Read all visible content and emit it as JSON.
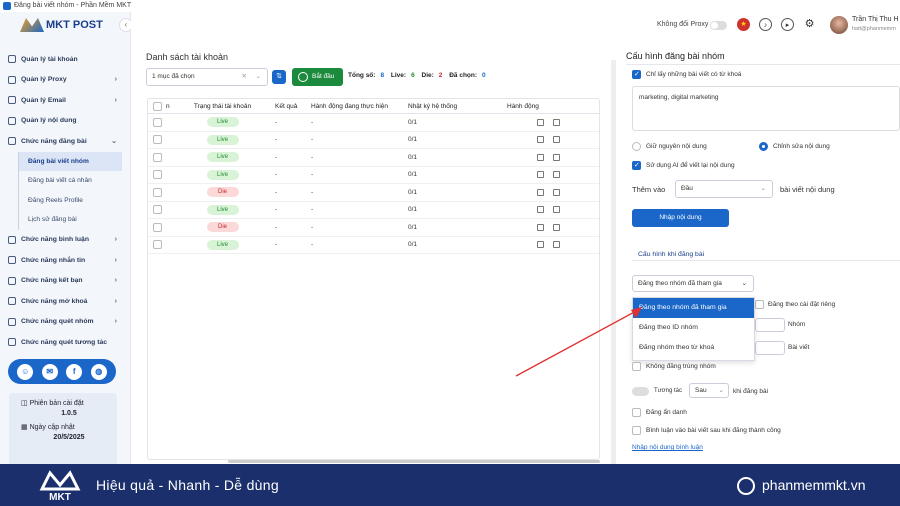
{
  "window": {
    "title": "Đăng bài viết nhóm - Phần Mềm MKT"
  },
  "app": {
    "logo_text": "MKT POST"
  },
  "header": {
    "proxy_label": "Không đổi Proxy",
    "user_name": "Trần Thị Thu H",
    "user_email": "hatt@phanmemm"
  },
  "sidebar": {
    "items": [
      {
        "label": "Quản lý tài khoản",
        "chevron": false
      },
      {
        "label": "Quản lý Proxy",
        "chevron": true
      },
      {
        "label": "Quản lý Email",
        "chevron": true
      },
      {
        "label": "Quản lý nội dung",
        "chevron": false
      },
      {
        "label": "Chức năng đăng bài",
        "chevron": true,
        "expanded": true
      }
    ],
    "sub_items": [
      {
        "label": "Đăng bài viết nhóm",
        "active": true
      },
      {
        "label": "Đăng bài viết cá nhân",
        "active": false
      },
      {
        "label": "Đăng Reels Profile",
        "active": false
      },
      {
        "label": "Lịch sử đăng bài",
        "active": false
      }
    ],
    "items2": [
      {
        "label": "Chức năng bình luận"
      },
      {
        "label": "Chức năng nhắn tin"
      },
      {
        "label": "Chức năng kết bạn"
      },
      {
        "label": "Chức năng mở khoá"
      },
      {
        "label": "Chức năng quét nhóm"
      },
      {
        "label": "Chức năng quét tương tác"
      }
    ],
    "version_label": "Phiên bản cài đặt",
    "version": "1.0.5",
    "update_label": "Ngày cập nhật",
    "update_date": "20/5/2025"
  },
  "accounts": {
    "title": "Danh sách tài khoản",
    "selected_text": "1 mục đã chọn",
    "start_label": "Bắt đầu",
    "total_label": "Tổng số:",
    "total": "8",
    "live_label": "Live:",
    "live": "6",
    "die_label": "Die:",
    "die": "2",
    "chosen_label": "Đã chọn:",
    "chosen": "0",
    "columns": [
      "n",
      "Trạng thái tài khoản",
      "Kết quả",
      "Hành động đang thực hiện",
      "Nhật ký hệ thống",
      "Hành động"
    ],
    "rows": [
      {
        "status": "Live",
        "result": "-",
        "action": "-",
        "log": "0/1"
      },
      {
        "status": "Live",
        "result": "-",
        "action": "-",
        "log": "0/1"
      },
      {
        "status": "Live",
        "result": "-",
        "action": "-",
        "log": "0/1"
      },
      {
        "status": "Live",
        "result": "-",
        "action": "-",
        "log": "0/1"
      },
      {
        "status": "Die",
        "result": "-",
        "action": "-",
        "log": "0/1"
      },
      {
        "status": "Live",
        "result": "-",
        "action": "-",
        "log": "0/1"
      },
      {
        "status": "Die",
        "result": "-",
        "action": "-",
        "log": "0/1"
      },
      {
        "status": "Live",
        "result": "-",
        "action": "-",
        "log": "0/1"
      }
    ]
  },
  "config": {
    "title": "Cấu hình đăng bài nhóm",
    "only_keyword": "Chỉ lấy những bài viết có từ khoá",
    "keywords": "marketing, digital marketing",
    "keep_content": "Giữ nguyên nội dung",
    "edit_content": "Chỉnh sửa nội dung",
    "use_ai": "Sử dụng AI để viết lại nội dung",
    "add_label": "Thêm vào",
    "add_value": "Đầu",
    "add_suffix": "bài viết nội dung",
    "input_button": "Nhập nội dung",
    "post_config_title": "Cấu hình khi đăng bài",
    "mode_selected": "Đăng theo nhóm đã tham gia",
    "mode_options": [
      "Đăng theo nhóm đã tham gia",
      "Đăng theo ID nhóm",
      "Đăng nhóm theo từ khoá"
    ],
    "private_setting": "Đăng theo cài đặt riêng",
    "group_unit": "Nhóm",
    "post_unit": "Bài viết",
    "no_duplicate": "Không đăng trùng nhóm",
    "interact_label": "Tương tác",
    "interact_value": "Sau",
    "interact_suffix": "khi đăng bài",
    "anonymous": "Đăng ẩn danh",
    "comment_after": "Bình luận vào bài viết sau khi đăng thành công",
    "comment_link": "Nhập nội dung bình luận"
  },
  "banner": {
    "logo_text": "MKT",
    "slogan": "Hiệu quả - Nhanh - Dễ dùng",
    "website": "phanmemmkt.vn"
  },
  "colors": {
    "accent": "#1a66c9",
    "banner": "#1a2f6b",
    "start": "#1b8a3d"
  }
}
